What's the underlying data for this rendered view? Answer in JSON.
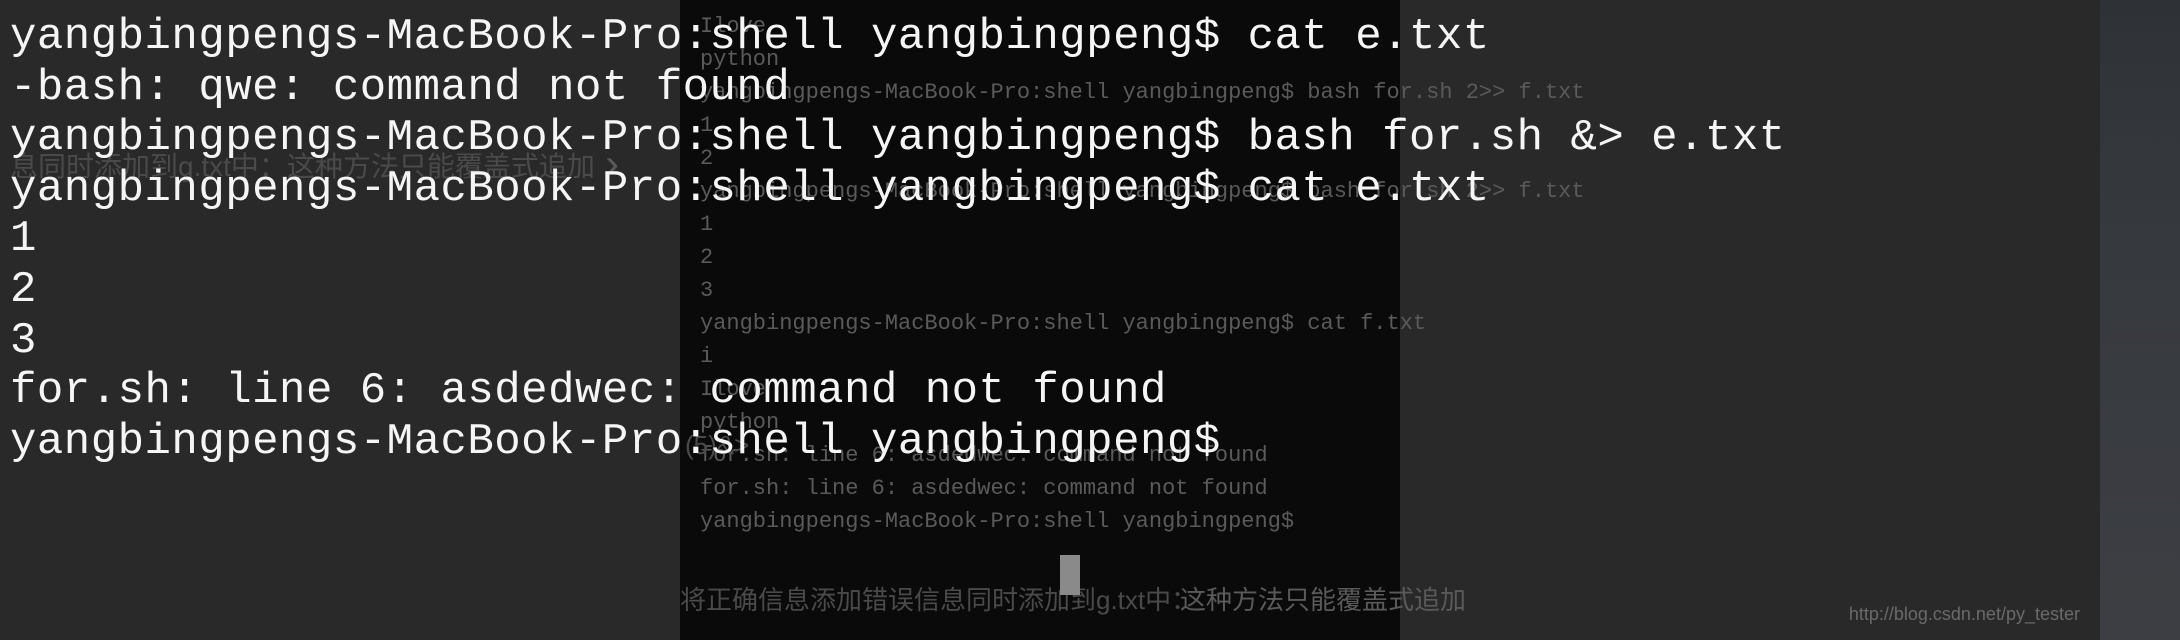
{
  "foreground": {
    "lines": [
      "yangbingpengs-MacBook-Pro:shell yangbingpeng$ cat e.txt",
      "-bash: qwe: command not found",
      "yangbingpengs-MacBook-Pro:shell yangbingpeng$ bash for.sh &> e.txt",
      "yangbingpengs-MacBook-Pro:shell yangbingpeng$ cat e.txt",
      "1",
      "2",
      "3",
      "for.sh: line 6: asdedwec: command not found",
      "yangbingpengs-MacBook-Pro:shell yangbingpeng$ "
    ]
  },
  "background": {
    "terminal_lines": [
      "Ilove",
      "python",
      "yangbingpengs-MacBook-Pro:shell yangbingpeng$ bash for.sh 2>> f.txt",
      "1",
      "2",
      "yangbingpengs-MacBook-Pro:shell yangbingpeng$ bash for.sh 2>> f.txt",
      "1",
      "2",
      "3",
      "yangbingpengs-MacBook-Pro:shell yangbingpeng$ cat f.txt",
      "i",
      "Ilove",
      "python",
      "for.sh: line 6: asdedwec: command not found",
      "for.sh: line 6: asdedwec: command not found",
      "yangbingpengs-MacBook-Pro:shell yangbingpeng$ "
    ],
    "left_text": "息同时添加到g.txt中：这种方法只能覆盖式追加",
    "right_text": "将正确信息添加错误信息同时添加到g.txt中：",
    "right_text2": "这种方法只能覆盖式追加",
    "num5": "(5)&>",
    "watermark": "http://blog.csdn.net/py_tester"
  }
}
